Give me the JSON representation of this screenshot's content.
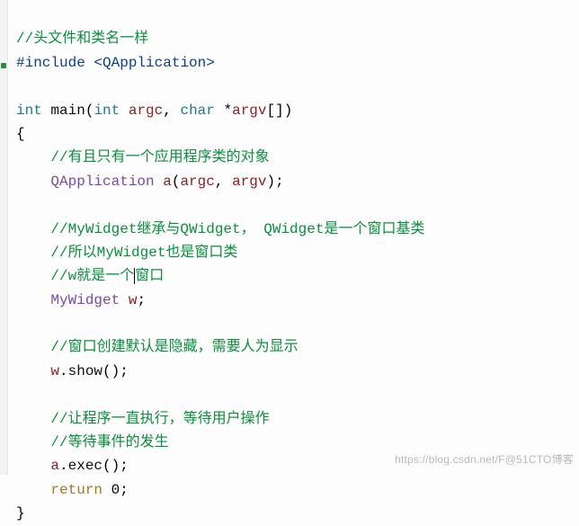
{
  "code": {
    "c1": "//头文件和类名一样",
    "inc": "#include ",
    "inc_lt": "<",
    "inc_hdr": "QApplication",
    "inc_gt": ">",
    "kw_int": "int",
    "main": " main",
    "lp": "(",
    "kw_int2": "int",
    "argc": " argc",
    "comma": ", ",
    "kw_char": "char",
    "sp": " ",
    "star": "*",
    "argv": "argv",
    "lbr": "[",
    "rbr": "]",
    "rp": ")",
    "lcb": "{",
    "c2": "//有且只有一个应用程序类的对象",
    "qapp": "QApplication",
    "a_decl_sp": " ",
    "a_var": "a",
    "a_lp": "(",
    "a_arg1": "argc",
    "a_comma": ", ",
    "a_arg2": "argv",
    "a_rp": ")",
    "a_semi": ";",
    "c3": "//MyWidget继承与QWidget， QWidget是一个窗口基类",
    "c4": "//所以MyWidget也是窗口类",
    "c5a": "//w就是一个",
    "c5b": "窗口",
    "mywidget": "MyWidget",
    "w_sp": " ",
    "w_var": "w",
    "w_semi": ";",
    "c6": "//窗口创建默认是隐藏，需要人为显示",
    "w_call_obj": "w",
    "dot": ".",
    "show": "show",
    "call_lp": "(",
    "call_rp": ")",
    "semi": ";",
    "c7": "//让程序一直执行，等待用户操作",
    "c8": "//等待事件的发生",
    "a_obj": "a",
    "dot2": ".",
    "exec": "exec",
    "call_lp2": "(",
    "call_rp2": ")",
    "semi2": ";",
    "kw_return": "return",
    "ret_sp": " ",
    "zero": "0",
    "semi3": ";",
    "rcb": "}"
  },
  "watermark": "https://blog.csdn.net/F@51CTO博客"
}
